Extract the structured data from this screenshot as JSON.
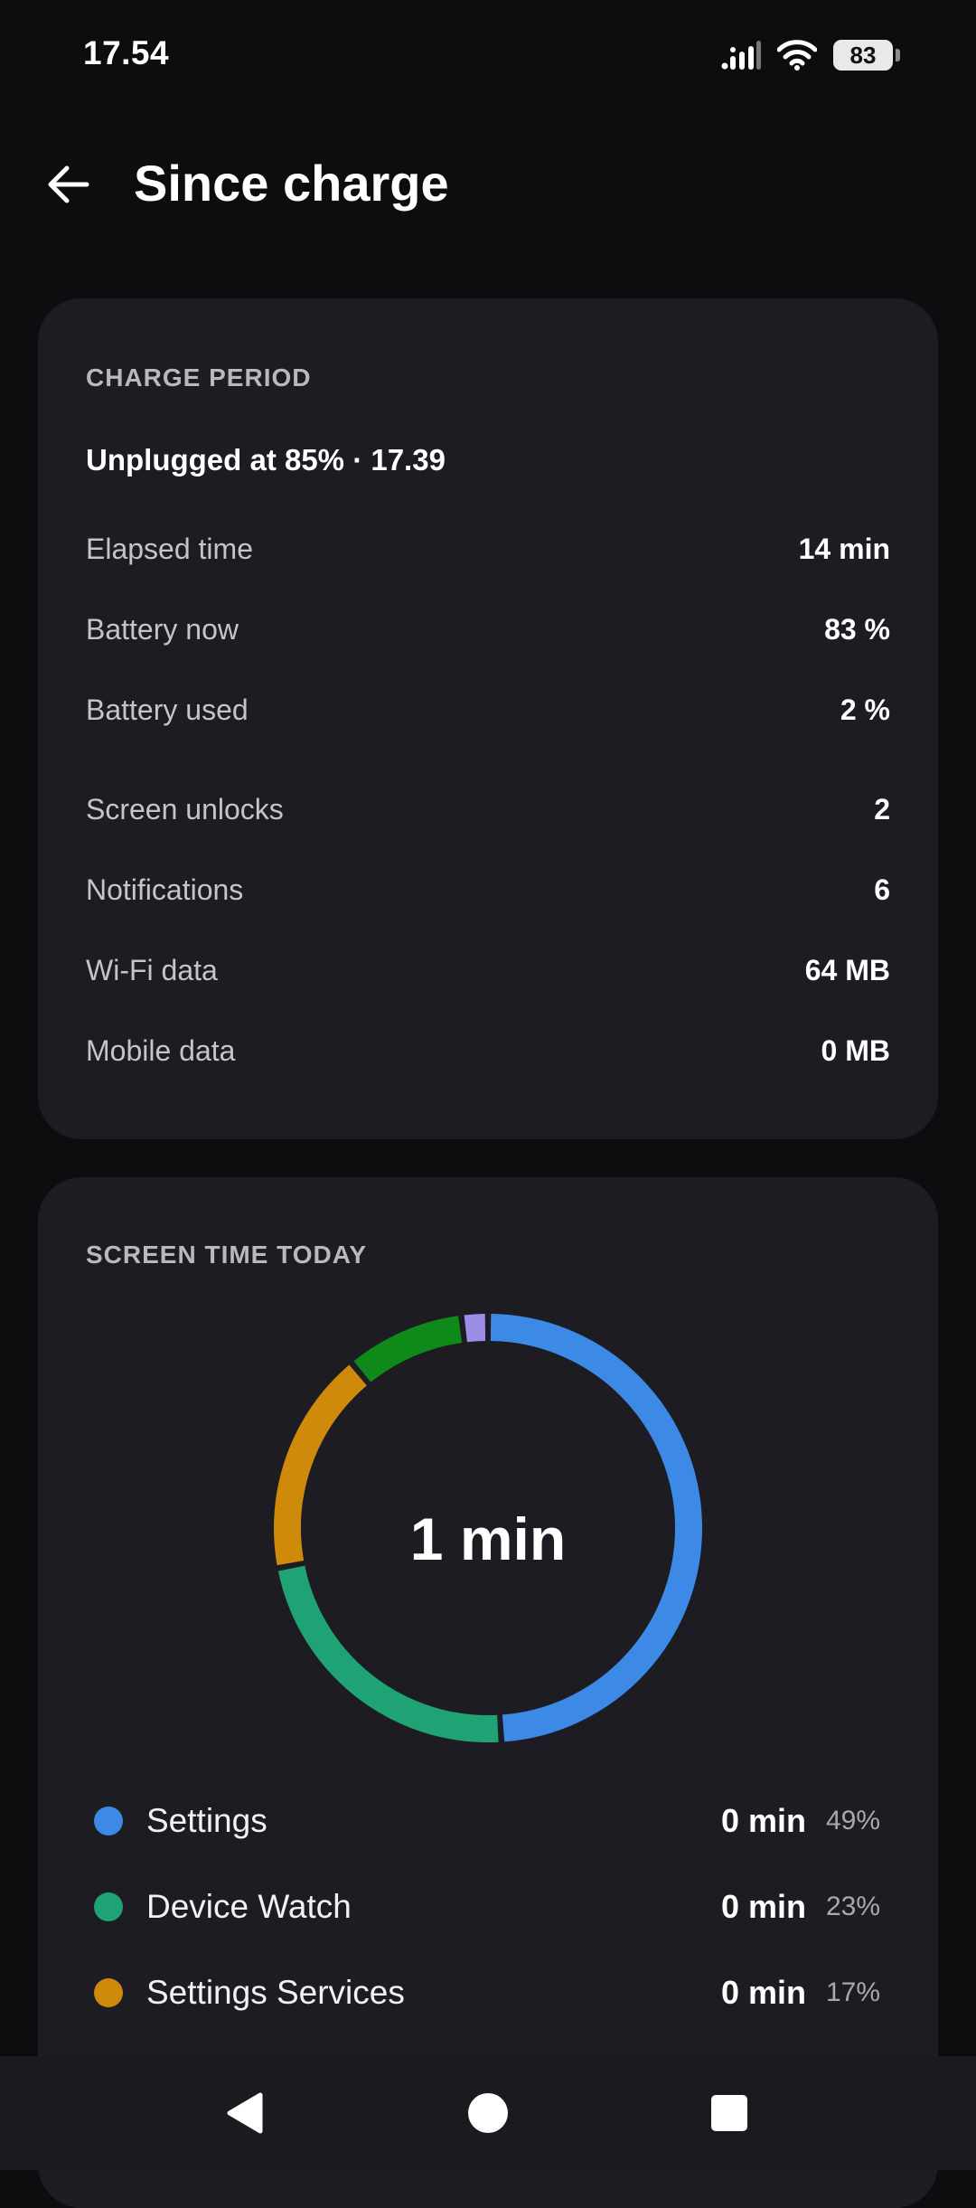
{
  "status_bar": {
    "time": "17.54",
    "battery_level": "83",
    "icons": [
      "signal-icon",
      "wifi-icon",
      "battery-icon"
    ]
  },
  "header": {
    "title": "Since charge",
    "back_icon": "arrow-left-icon"
  },
  "charge_card": {
    "label": "CHARGE PERIOD",
    "summary": "Unplugged at 85% · 17.39",
    "rows": [
      {
        "label": "Elapsed time",
        "value": "14 min"
      },
      {
        "label": "Battery now",
        "value": "83 %"
      },
      {
        "label": "Battery used",
        "value": "2 %"
      },
      {
        "label": "Screen unlocks",
        "value": "2"
      },
      {
        "label": "Notifications",
        "value": "6"
      },
      {
        "label": "Wi-Fi data",
        "value": "64 MB"
      },
      {
        "label": "Mobile data",
        "value": "0 MB"
      }
    ]
  },
  "screen_time_card": {
    "label": "SCREEN TIME TODAY",
    "center_text": "1 min",
    "apps": [
      {
        "name": "Settings",
        "time": "0 min",
        "percent": "49%",
        "color": "#3d8ae6"
      },
      {
        "name": "Device Watch",
        "time": "0 min",
        "percent": "23%",
        "color": "#1fa374"
      },
      {
        "name": "Settings Services",
        "time": "0 min",
        "percent": "17%",
        "color": "#cf8a0b"
      }
    ]
  },
  "chart_data": {
    "type": "pie",
    "title": "",
    "categories": [
      "Settings",
      "Device Watch",
      "Settings Services",
      "",
      ""
    ],
    "values": [
      49,
      23,
      17,
      9,
      2
    ],
    "colors": [
      "#3d8ae6",
      "#1fa374",
      "#cf8a0b",
      "#0f8a1a",
      "#9b8ee6"
    ]
  },
  "nav_bar": {
    "icons": [
      "back-triangle-icon",
      "home-circle-icon",
      "recents-square-icon"
    ]
  }
}
